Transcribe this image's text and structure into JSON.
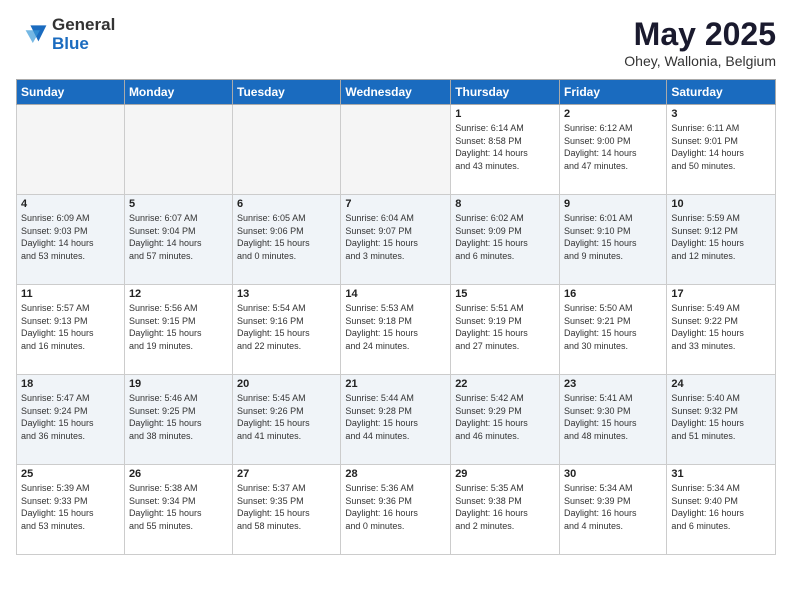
{
  "logo": {
    "general": "General",
    "blue": "Blue"
  },
  "title": {
    "month": "May 2025",
    "location": "Ohey, Wallonia, Belgium"
  },
  "weekdays": [
    "Sunday",
    "Monday",
    "Tuesday",
    "Wednesday",
    "Thursday",
    "Friday",
    "Saturday"
  ],
  "weeks": [
    [
      {
        "day": "",
        "info": ""
      },
      {
        "day": "",
        "info": ""
      },
      {
        "day": "",
        "info": ""
      },
      {
        "day": "",
        "info": ""
      },
      {
        "day": "1",
        "info": "Sunrise: 6:14 AM\nSunset: 8:58 PM\nDaylight: 14 hours\nand 43 minutes."
      },
      {
        "day": "2",
        "info": "Sunrise: 6:12 AM\nSunset: 9:00 PM\nDaylight: 14 hours\nand 47 minutes."
      },
      {
        "day": "3",
        "info": "Sunrise: 6:11 AM\nSunset: 9:01 PM\nDaylight: 14 hours\nand 50 minutes."
      }
    ],
    [
      {
        "day": "4",
        "info": "Sunrise: 6:09 AM\nSunset: 9:03 PM\nDaylight: 14 hours\nand 53 minutes."
      },
      {
        "day": "5",
        "info": "Sunrise: 6:07 AM\nSunset: 9:04 PM\nDaylight: 14 hours\nand 57 minutes."
      },
      {
        "day": "6",
        "info": "Sunrise: 6:05 AM\nSunset: 9:06 PM\nDaylight: 15 hours\nand 0 minutes."
      },
      {
        "day": "7",
        "info": "Sunrise: 6:04 AM\nSunset: 9:07 PM\nDaylight: 15 hours\nand 3 minutes."
      },
      {
        "day": "8",
        "info": "Sunrise: 6:02 AM\nSunset: 9:09 PM\nDaylight: 15 hours\nand 6 minutes."
      },
      {
        "day": "9",
        "info": "Sunrise: 6:01 AM\nSunset: 9:10 PM\nDaylight: 15 hours\nand 9 minutes."
      },
      {
        "day": "10",
        "info": "Sunrise: 5:59 AM\nSunset: 9:12 PM\nDaylight: 15 hours\nand 12 minutes."
      }
    ],
    [
      {
        "day": "11",
        "info": "Sunrise: 5:57 AM\nSunset: 9:13 PM\nDaylight: 15 hours\nand 16 minutes."
      },
      {
        "day": "12",
        "info": "Sunrise: 5:56 AM\nSunset: 9:15 PM\nDaylight: 15 hours\nand 19 minutes."
      },
      {
        "day": "13",
        "info": "Sunrise: 5:54 AM\nSunset: 9:16 PM\nDaylight: 15 hours\nand 22 minutes."
      },
      {
        "day": "14",
        "info": "Sunrise: 5:53 AM\nSunset: 9:18 PM\nDaylight: 15 hours\nand 24 minutes."
      },
      {
        "day": "15",
        "info": "Sunrise: 5:51 AM\nSunset: 9:19 PM\nDaylight: 15 hours\nand 27 minutes."
      },
      {
        "day": "16",
        "info": "Sunrise: 5:50 AM\nSunset: 9:21 PM\nDaylight: 15 hours\nand 30 minutes."
      },
      {
        "day": "17",
        "info": "Sunrise: 5:49 AM\nSunset: 9:22 PM\nDaylight: 15 hours\nand 33 minutes."
      }
    ],
    [
      {
        "day": "18",
        "info": "Sunrise: 5:47 AM\nSunset: 9:24 PM\nDaylight: 15 hours\nand 36 minutes."
      },
      {
        "day": "19",
        "info": "Sunrise: 5:46 AM\nSunset: 9:25 PM\nDaylight: 15 hours\nand 38 minutes."
      },
      {
        "day": "20",
        "info": "Sunrise: 5:45 AM\nSunset: 9:26 PM\nDaylight: 15 hours\nand 41 minutes."
      },
      {
        "day": "21",
        "info": "Sunrise: 5:44 AM\nSunset: 9:28 PM\nDaylight: 15 hours\nand 44 minutes."
      },
      {
        "day": "22",
        "info": "Sunrise: 5:42 AM\nSunset: 9:29 PM\nDaylight: 15 hours\nand 46 minutes."
      },
      {
        "day": "23",
        "info": "Sunrise: 5:41 AM\nSunset: 9:30 PM\nDaylight: 15 hours\nand 48 minutes."
      },
      {
        "day": "24",
        "info": "Sunrise: 5:40 AM\nSunset: 9:32 PM\nDaylight: 15 hours\nand 51 minutes."
      }
    ],
    [
      {
        "day": "25",
        "info": "Sunrise: 5:39 AM\nSunset: 9:33 PM\nDaylight: 15 hours\nand 53 minutes."
      },
      {
        "day": "26",
        "info": "Sunrise: 5:38 AM\nSunset: 9:34 PM\nDaylight: 15 hours\nand 55 minutes."
      },
      {
        "day": "27",
        "info": "Sunrise: 5:37 AM\nSunset: 9:35 PM\nDaylight: 15 hours\nand 58 minutes."
      },
      {
        "day": "28",
        "info": "Sunrise: 5:36 AM\nSunset: 9:36 PM\nDaylight: 16 hours\nand 0 minutes."
      },
      {
        "day": "29",
        "info": "Sunrise: 5:35 AM\nSunset: 9:38 PM\nDaylight: 16 hours\nand 2 minutes."
      },
      {
        "day": "30",
        "info": "Sunrise: 5:34 AM\nSunset: 9:39 PM\nDaylight: 16 hours\nand 4 minutes."
      },
      {
        "day": "31",
        "info": "Sunrise: 5:34 AM\nSunset: 9:40 PM\nDaylight: 16 hours\nand 6 minutes."
      }
    ]
  ]
}
